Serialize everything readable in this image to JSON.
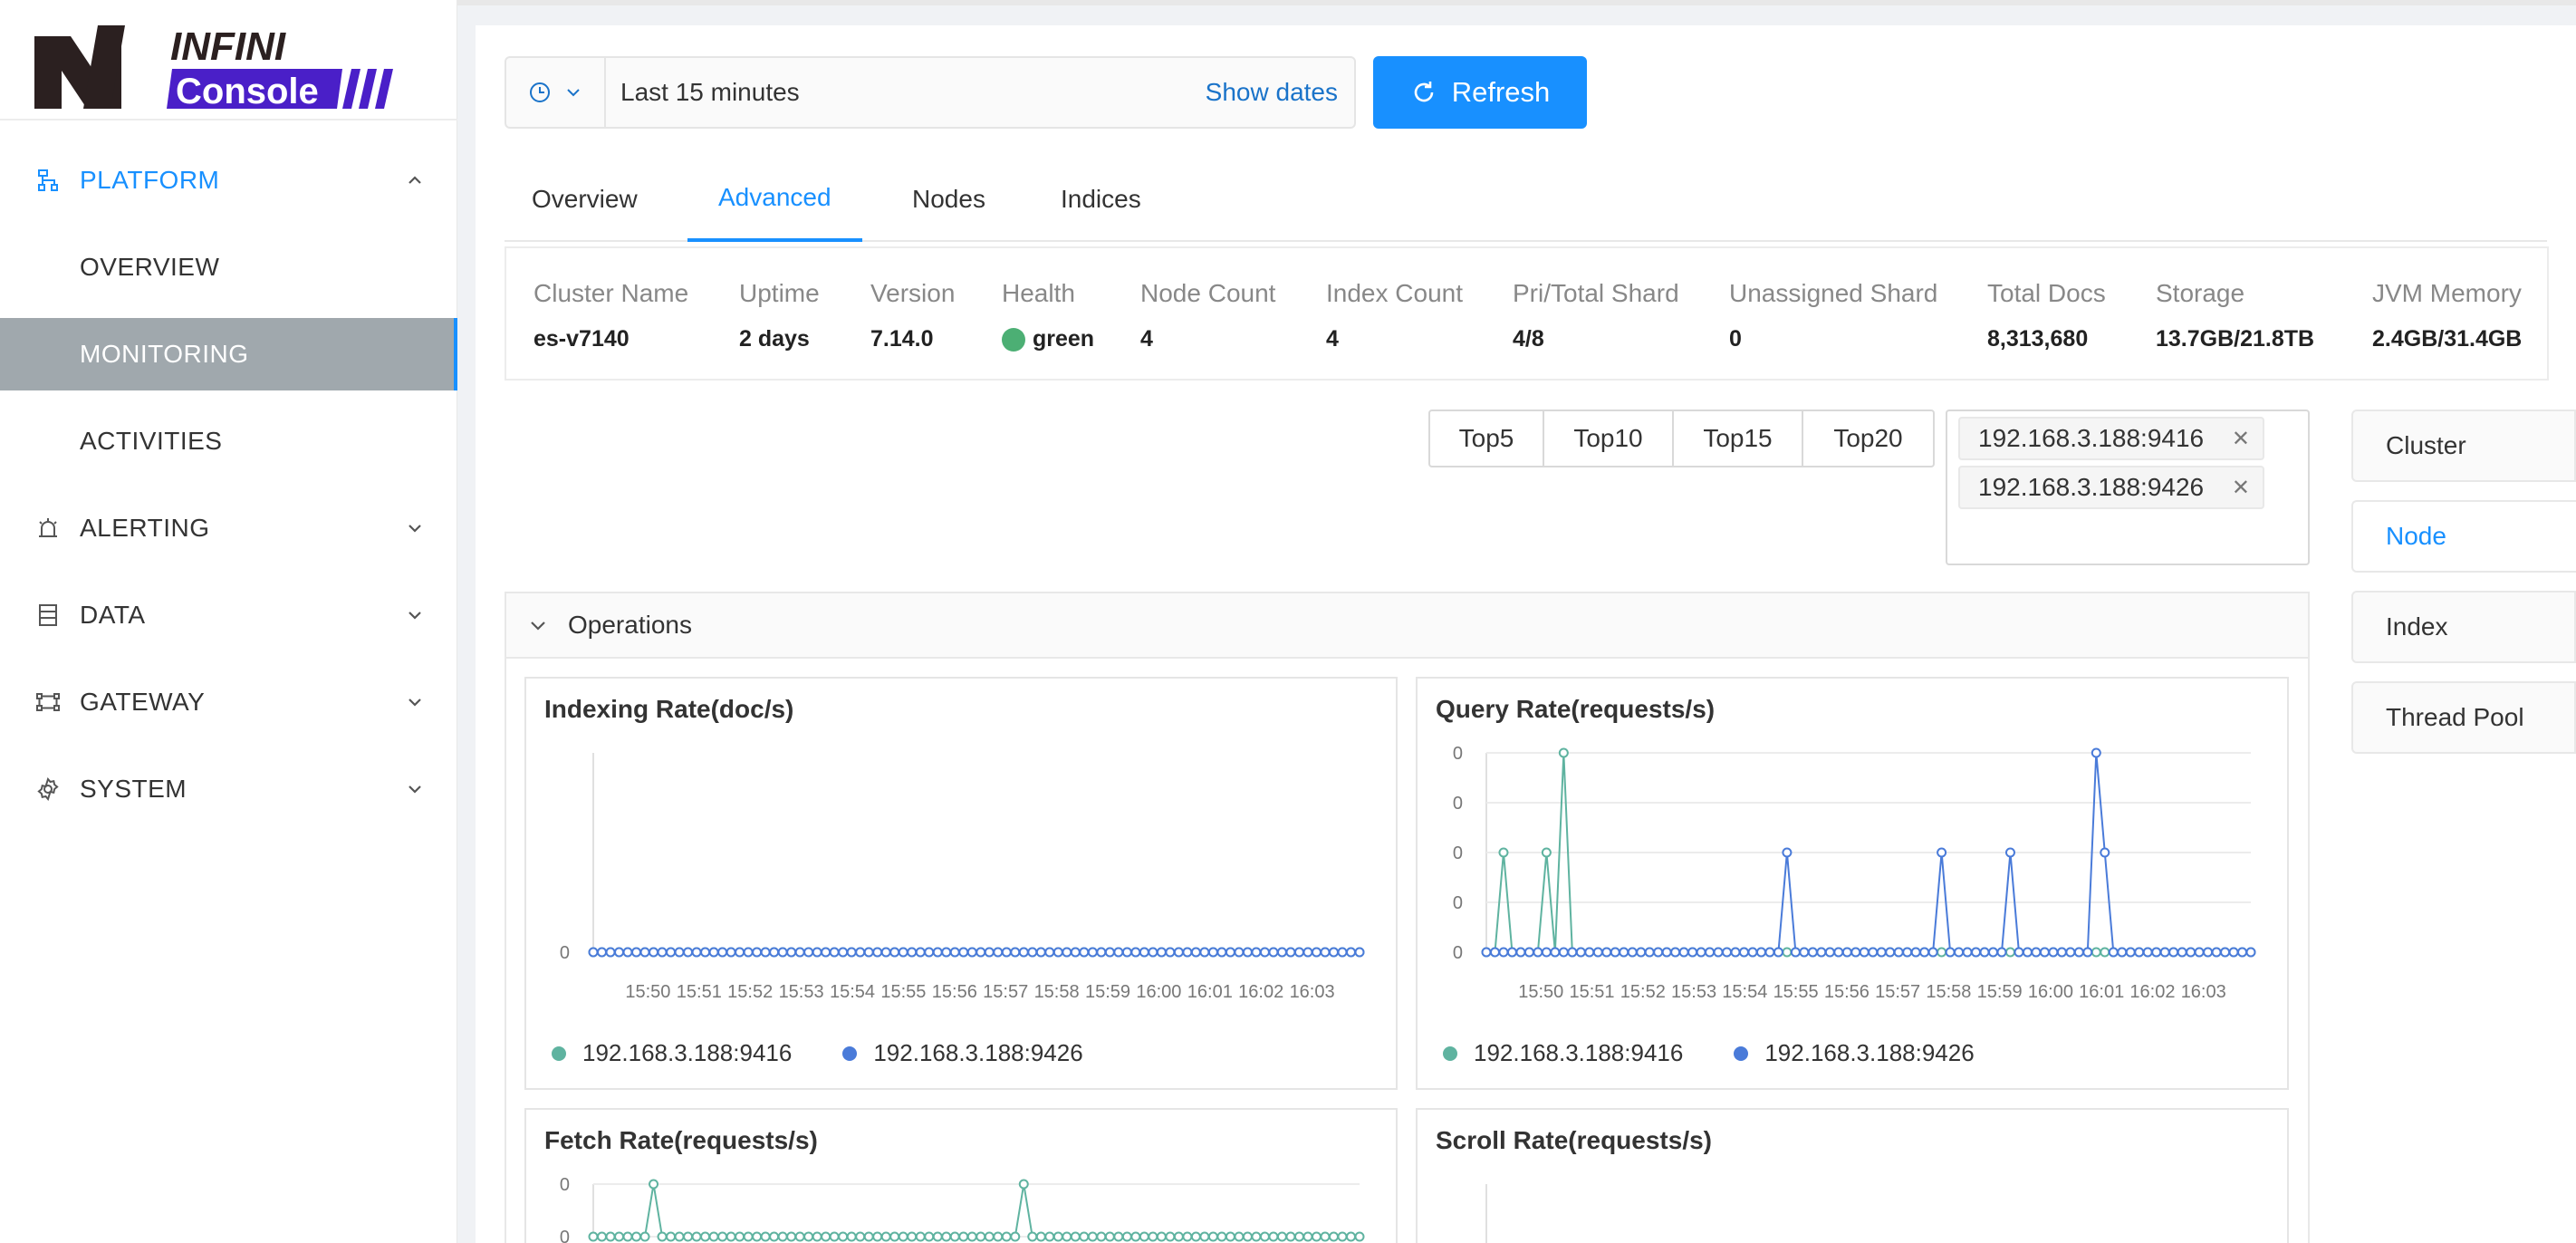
{
  "app": {
    "logo_text_top": "INFINI",
    "logo_text_bottom": "Console"
  },
  "sidebar": {
    "items": [
      {
        "label": "PLATFORM",
        "icon": "sitemap-icon",
        "state": "open"
      },
      {
        "label": "OVERVIEW",
        "sub": true
      },
      {
        "label": "MONITORING",
        "sub": true,
        "state": "active"
      },
      {
        "label": "ACTIVITIES",
        "sub": true
      },
      {
        "label": "ALERTING",
        "icon": "alarm-icon"
      },
      {
        "label": "DATA",
        "icon": "database-icon"
      },
      {
        "label": "GATEWAY",
        "icon": "gateway-icon"
      },
      {
        "label": "SYSTEM",
        "icon": "gear-icon"
      }
    ]
  },
  "toolbar": {
    "time_range": "Last 15 minutes",
    "show_dates": "Show dates",
    "refresh_label": "Refresh"
  },
  "tabs": [
    {
      "label": "Overview"
    },
    {
      "label": "Advanced",
      "active": true
    },
    {
      "label": "Nodes"
    },
    {
      "label": "Indices"
    }
  ],
  "cluster_info": [
    {
      "label": "Cluster Name",
      "value": "es-v7140"
    },
    {
      "label": "Uptime",
      "value": "2 days"
    },
    {
      "label": "Version",
      "value": "7.14.0"
    },
    {
      "label": "Health",
      "value": "green"
    },
    {
      "label": "Node Count",
      "value": "4"
    },
    {
      "label": "Index Count",
      "value": "4"
    },
    {
      "label": "Pri/Total Shard",
      "value": "4/8"
    },
    {
      "label": "Unassigned Shard",
      "value": "0"
    },
    {
      "label": "Total Docs",
      "value": "8,313,680"
    },
    {
      "label": "Storage",
      "value": "13.7GB/21.8TB"
    },
    {
      "label": "JVM Memory",
      "value": "2.4GB/31.4GB"
    }
  ],
  "top_n": [
    "Top5",
    "Top10",
    "Top15",
    "Top20"
  ],
  "node_select": {
    "tags": [
      "192.168.3.188:9416",
      "192.168.3.188:9426"
    ]
  },
  "side_tabs": [
    {
      "label": "Cluster"
    },
    {
      "label": "Node",
      "active": true
    },
    {
      "label": "Index"
    },
    {
      "label": "Thread Pool"
    }
  ],
  "colors": {
    "accent": "#1890ff",
    "series_1": "#5fb3a0",
    "series_2": "#4a7bd9",
    "health_green": "#4caf74"
  },
  "operations": {
    "title": "Operations"
  },
  "chart_data": [
    {
      "type": "line",
      "title": "Indexing Rate(doc/s)",
      "x": [
        "15:50",
        "15:51",
        "15:52",
        "15:53",
        "15:54",
        "15:55",
        "15:56",
        "15:57",
        "15:58",
        "15:59",
        "16:00",
        "16:01",
        "16:02",
        "16:03"
      ],
      "y_ticks": [
        "0"
      ],
      "series": [
        {
          "name": "192.168.3.188:9416",
          "values": [
            0,
            0,
            0,
            0,
            0,
            0,
            0,
            0,
            0,
            0,
            0,
            0,
            0,
            0,
            0,
            0,
            0,
            0,
            0,
            0,
            0,
            0,
            0,
            0,
            0,
            0,
            0,
            0,
            0,
            0,
            0,
            0,
            0,
            0,
            0,
            0,
            0,
            0,
            0,
            0,
            0,
            0,
            0,
            0,
            0,
            0,
            0,
            0,
            0,
            0,
            0,
            0,
            0,
            0,
            0,
            0,
            0,
            0,
            0,
            0,
            0,
            0,
            0,
            0,
            0,
            0,
            0,
            0,
            0,
            0,
            0,
            0,
            0,
            0,
            0,
            0,
            0,
            0,
            0,
            0,
            0,
            0,
            0,
            0,
            0,
            0,
            0,
            0,
            0,
            0
          ]
        },
        {
          "name": "192.168.3.188:9426",
          "values": [
            0,
            0,
            0,
            0,
            0,
            0,
            0,
            0,
            0,
            0,
            0,
            0,
            0,
            0,
            0,
            0,
            0,
            0,
            0,
            0,
            0,
            0,
            0,
            0,
            0,
            0,
            0,
            0,
            0,
            0,
            0,
            0,
            0,
            0,
            0,
            0,
            0,
            0,
            0,
            0,
            0,
            0,
            0,
            0,
            0,
            0,
            0,
            0,
            0,
            0,
            0,
            0,
            0,
            0,
            0,
            0,
            0,
            0,
            0,
            0,
            0,
            0,
            0,
            0,
            0,
            0,
            0,
            0,
            0,
            0,
            0,
            0,
            0,
            0,
            0,
            0,
            0,
            0,
            0,
            0,
            0,
            0,
            0,
            0,
            0,
            0,
            0,
            0,
            0,
            0
          ]
        }
      ]
    },
    {
      "type": "line",
      "title": "Query Rate(requests/s)",
      "x": [
        "15:50",
        "15:51",
        "15:52",
        "15:53",
        "15:54",
        "15:55",
        "15:56",
        "15:57",
        "15:58",
        "15:59",
        "16:00",
        "16:01",
        "16:02",
        "16:03"
      ],
      "y_ticks": [
        "0",
        "0",
        "0",
        "0",
        "0"
      ],
      "series": [
        {
          "name": "192.168.3.188:9416",
          "values": [
            0,
            0,
            0.02,
            0,
            0,
            0,
            0,
            0.02,
            0,
            0.04,
            0,
            0,
            0,
            0,
            0,
            0,
            0,
            0,
            0,
            0,
            0,
            0,
            0,
            0,
            0,
            0,
            0,
            0,
            0,
            0,
            0,
            0,
            0,
            0,
            0,
            0,
            0,
            0,
            0,
            0,
            0,
            0,
            0,
            0,
            0,
            0,
            0,
            0,
            0,
            0,
            0,
            0,
            0,
            0,
            0,
            0,
            0,
            0,
            0,
            0,
            0,
            0,
            0,
            0,
            0,
            0,
            0,
            0,
            0,
            0,
            0,
            0,
            0,
            0,
            0,
            0,
            0,
            0,
            0,
            0,
            0,
            0,
            0,
            0,
            0,
            0,
            0,
            0,
            0,
            0
          ]
        },
        {
          "name": "192.168.3.188:9426",
          "values": [
            0,
            0,
            0,
            0,
            0,
            0,
            0,
            0,
            0,
            0,
            0,
            0,
            0,
            0,
            0,
            0,
            0,
            0,
            0,
            0,
            0,
            0,
            0,
            0,
            0,
            0,
            0,
            0,
            0,
            0,
            0,
            0,
            0,
            0,
            0,
            0.02,
            0,
            0,
            0,
            0,
            0,
            0,
            0,
            0,
            0,
            0,
            0,
            0,
            0,
            0,
            0,
            0,
            0,
            0.02,
            0,
            0,
            0,
            0,
            0,
            0,
            0,
            0.02,
            0,
            0,
            0,
            0,
            0,
            0,
            0,
            0,
            0,
            0.04,
            0.02,
            0,
            0,
            0,
            0,
            0,
            0,
            0,
            0,
            0,
            0,
            0,
            0,
            0,
            0,
            0,
            0,
            0
          ]
        }
      ]
    },
    {
      "type": "line",
      "title": "Fetch Rate(requests/s)",
      "y_ticks": [
        "0",
        "0"
      ],
      "series": [
        {
          "name": "192.168.3.188:9416",
          "values": [
            0,
            0,
            0,
            0,
            0,
            0,
            0,
            0.02,
            0,
            0,
            0,
            0,
            0,
            0,
            0,
            0,
            0,
            0,
            0,
            0,
            0,
            0,
            0,
            0,
            0,
            0,
            0,
            0,
            0,
            0,
            0,
            0,
            0,
            0,
            0,
            0,
            0,
            0,
            0,
            0,
            0,
            0,
            0,
            0,
            0,
            0,
            0,
            0,
            0,
            0,
            0.02,
            0,
            0,
            0,
            0,
            0,
            0,
            0,
            0,
            0,
            0,
            0,
            0,
            0,
            0,
            0,
            0,
            0,
            0,
            0,
            0,
            0,
            0,
            0,
            0,
            0,
            0,
            0,
            0,
            0,
            0,
            0,
            0,
            0,
            0,
            0,
            0,
            0,
            0,
            0
          ]
        }
      ]
    },
    {
      "type": "line",
      "title": "Scroll Rate(requests/s)",
      "series": []
    }
  ]
}
